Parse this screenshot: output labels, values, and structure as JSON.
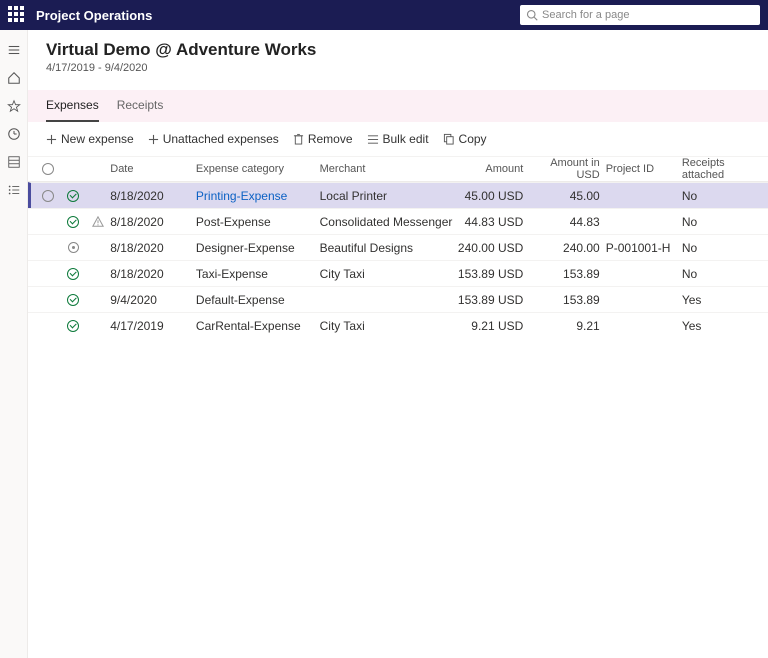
{
  "app": {
    "title": "Project Operations"
  },
  "search": {
    "placeholder": "Search for a page"
  },
  "page": {
    "title": "Virtual Demo @ Adventure Works",
    "date_range": "4/17/2019 - 9/4/2020"
  },
  "tabs": {
    "expenses": "Expenses",
    "receipts": "Receipts"
  },
  "toolbar": {
    "new_expense": "New expense",
    "unattached": "Unattached expenses",
    "remove": "Remove",
    "bulk_edit": "Bulk edit",
    "copy": "Copy"
  },
  "columns": {
    "date": "Date",
    "category": "Expense category",
    "merchant": "Merchant",
    "amount": "Amount",
    "amount_usd": "Amount in USD",
    "project_id": "Project ID",
    "receipts": "Receipts attached"
  },
  "rows": [
    {
      "selected": true,
      "status": "ok",
      "warn": false,
      "date": "8/18/2020",
      "category": "Printing-Expense",
      "category_link": true,
      "merchant": "Local Printer",
      "amount": "45.00 USD",
      "usd": "45.00",
      "project_id": "",
      "receipts": "No"
    },
    {
      "selected": false,
      "status": "ok",
      "warn": true,
      "date": "8/18/2020",
      "category": "Post-Expense",
      "category_link": false,
      "merchant": "Consolidated Messenger",
      "amount": "44.83 USD",
      "usd": "44.83",
      "project_id": "",
      "receipts": "No"
    },
    {
      "selected": false,
      "status": "pending",
      "warn": false,
      "date": "8/18/2020",
      "category": "Designer-Expense",
      "category_link": false,
      "merchant": "Beautiful Designs",
      "amount": "240.00 USD",
      "usd": "240.00",
      "project_id": "P-001001-H",
      "receipts": "No"
    },
    {
      "selected": false,
      "status": "ok",
      "warn": false,
      "date": "8/18/2020",
      "category": "Taxi-Expense",
      "category_link": false,
      "merchant": "City Taxi",
      "amount": "153.89 USD",
      "usd": "153.89",
      "project_id": "",
      "receipts": "No"
    },
    {
      "selected": false,
      "status": "ok",
      "warn": false,
      "date": "9/4/2020",
      "category": "Default-Expense",
      "category_link": false,
      "merchant": "",
      "amount": "153.89 USD",
      "usd": "153.89",
      "project_id": "",
      "receipts": "Yes"
    },
    {
      "selected": false,
      "status": "ok",
      "warn": false,
      "date": "4/17/2019",
      "category": "CarRental-Expense",
      "category_link": false,
      "merchant": "City Taxi",
      "amount": "9.21 USD",
      "usd": "9.21",
      "project_id": "",
      "receipts": "Yes"
    }
  ]
}
